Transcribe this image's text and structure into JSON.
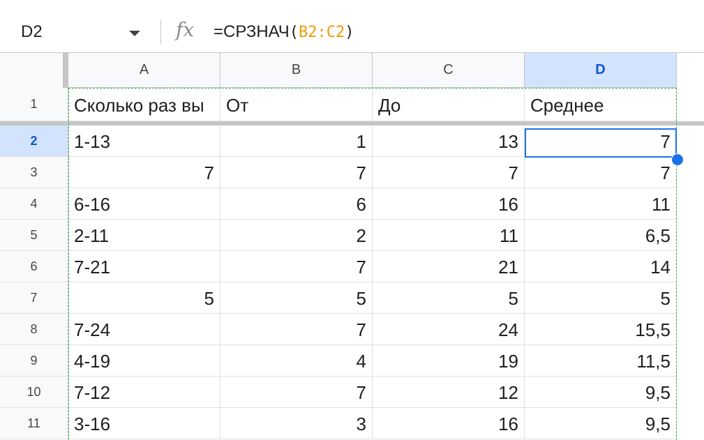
{
  "formula_bar": {
    "name_box": "D2",
    "fx_symbol": "fx",
    "formula_prefix": "=СРЗНАЧ",
    "formula_open": "(",
    "formula_range": "B2:C2",
    "formula_close": ")"
  },
  "columns": [
    "A",
    "B",
    "C",
    "D"
  ],
  "selected_cell": "D2",
  "colors": {
    "accent": "#1a73e8",
    "range_ref": "#f29900",
    "copy_border": "#34a853"
  },
  "header_row": {
    "number": "1",
    "cells": [
      "Сколько раз вы",
      "От",
      "До",
      "Среднее"
    ]
  },
  "rows": [
    {
      "number": "2",
      "cells": [
        "1-13",
        "1",
        "13",
        "7"
      ]
    },
    {
      "number": "3",
      "cells": [
        "7",
        "7",
        "7",
        "7"
      ]
    },
    {
      "number": "4",
      "cells": [
        "6-16",
        "6",
        "16",
        "11"
      ]
    },
    {
      "number": "5",
      "cells": [
        "2-11",
        "2",
        "11",
        "6,5"
      ]
    },
    {
      "number": "6",
      "cells": [
        "7-21",
        "7",
        "21",
        "14"
      ]
    },
    {
      "number": "7",
      "cells": [
        "5",
        "5",
        "5",
        "5"
      ]
    },
    {
      "number": "8",
      "cells": [
        "7-24",
        "7",
        "24",
        "15,5"
      ]
    },
    {
      "number": "9",
      "cells": [
        "4-19",
        "4",
        "19",
        "11,5"
      ]
    },
    {
      "number": "10",
      "cells": [
        "7-12",
        "7",
        "12",
        "9,5"
      ]
    },
    {
      "number": "11",
      "cells": [
        "3-16",
        "3",
        "16",
        "9,5"
      ]
    }
  ]
}
